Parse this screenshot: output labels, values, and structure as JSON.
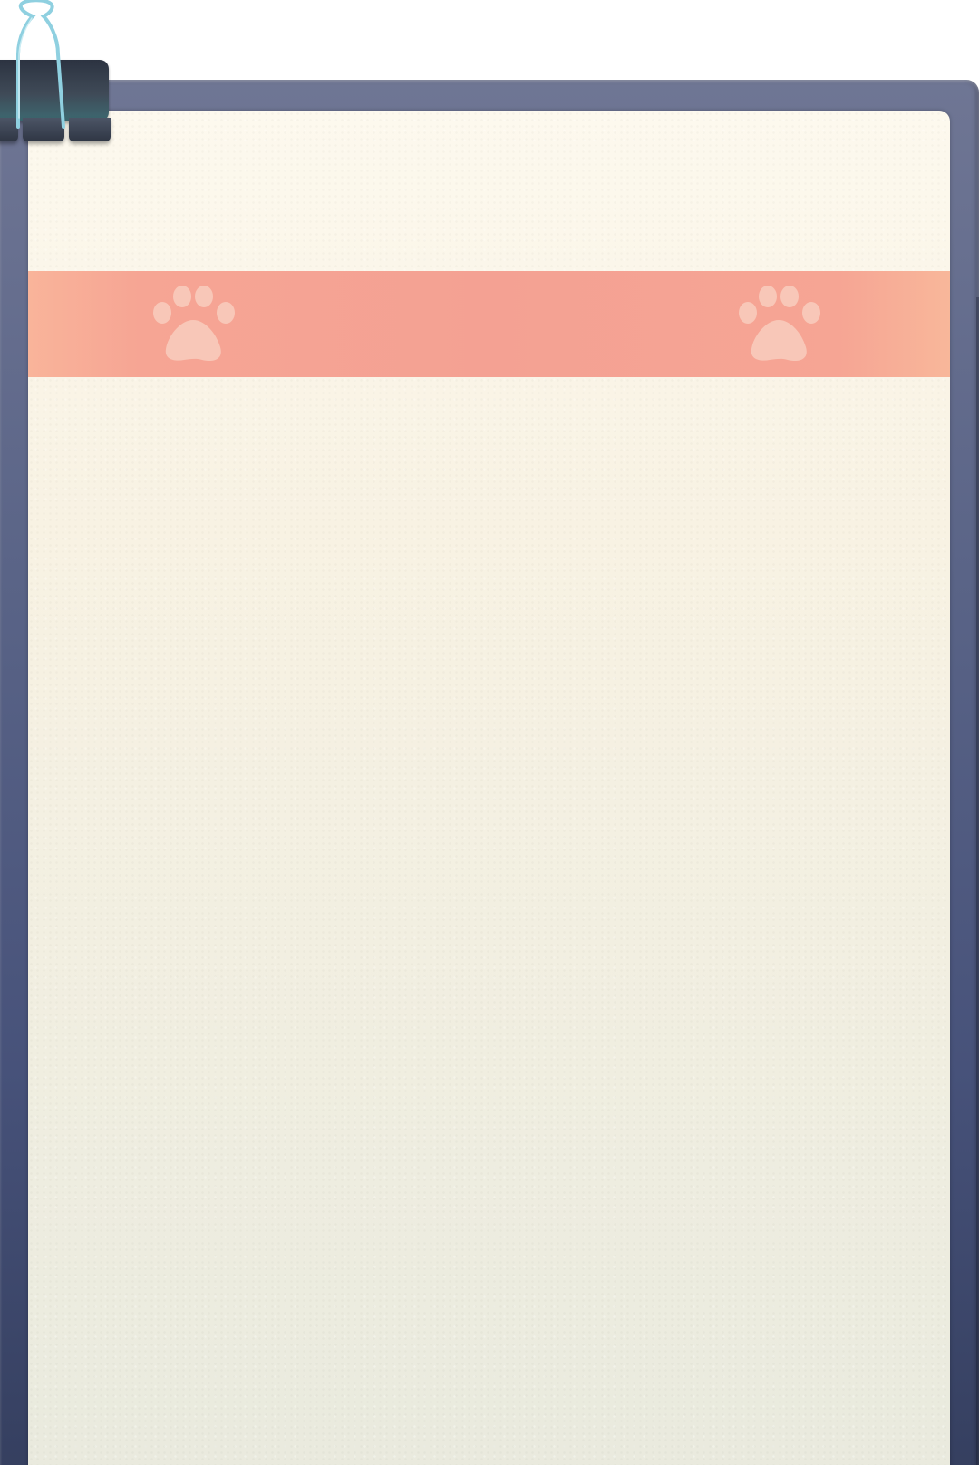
{
  "screen": {
    "title": "",
    "content_items": []
  },
  "colors": {
    "board_top": "#6f7694",
    "board_bottom": "#343e5e",
    "sheet_top": "#fdf9ee",
    "sheet_bottom": "#e9eade",
    "band": "#f4a193",
    "paw": "#fbe4d6",
    "clip": "#3f4a57",
    "clip_wire": "#8fd0e0"
  },
  "icons": {
    "clip": "binder-clip-icon",
    "paw_left": "paw-print-icon",
    "paw_right": "paw-print-icon"
  }
}
